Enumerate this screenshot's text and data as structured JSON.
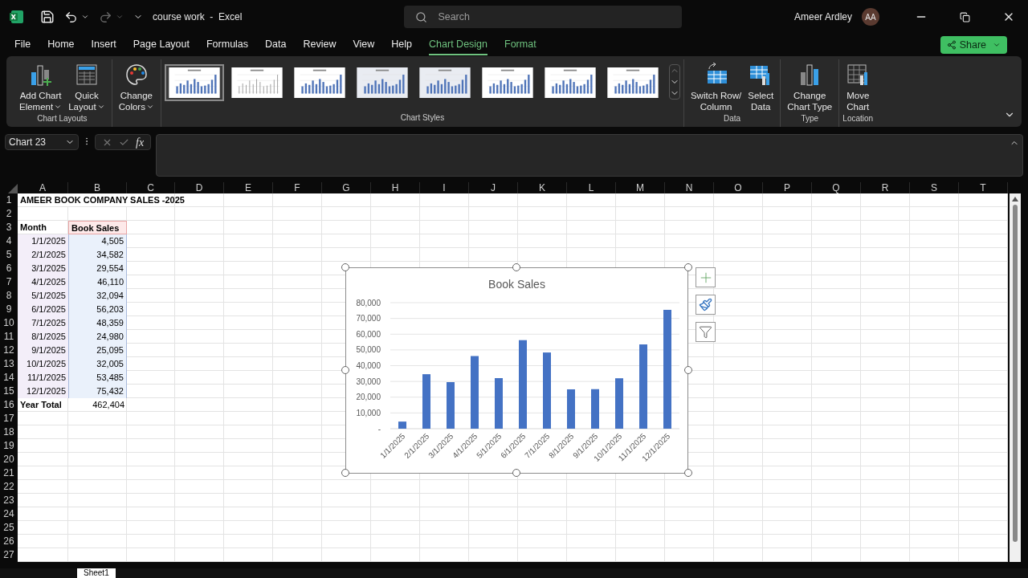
{
  "title_bar": {
    "document_title": "course work  -  Excel",
    "search": {
      "placeholder": "Search"
    },
    "user_name": "Ameer Ardley",
    "avatar_initials": "AA"
  },
  "menu_tabs": [
    {
      "label": "File",
      "selected": false,
      "contextual": false
    },
    {
      "label": "Home",
      "selected": false,
      "contextual": false
    },
    {
      "label": "Insert",
      "selected": false,
      "contextual": false
    },
    {
      "label": "Page Layout",
      "selected": false,
      "contextual": false
    },
    {
      "label": "Formulas",
      "selected": false,
      "contextual": false
    },
    {
      "label": "Data",
      "selected": false,
      "contextual": false
    },
    {
      "label": "Review",
      "selected": false,
      "contextual": false
    },
    {
      "label": "View",
      "selected": false,
      "contextual": false
    },
    {
      "label": "Help",
      "selected": false,
      "contextual": false
    },
    {
      "label": "Chart Design",
      "selected": true,
      "contextual": true
    },
    {
      "label": "Format",
      "selected": false,
      "contextual": true
    }
  ],
  "share_button": {
    "label": "Share"
  },
  "ribbon": {
    "groups": [
      {
        "label": "Chart Layouts",
        "kind": "buttons",
        "buttons": [
          {
            "lines": [
              "Add Chart",
              "Element"
            ],
            "dropdown": true
          },
          {
            "lines": [
              "Quick",
              "Layout"
            ],
            "dropdown": true
          }
        ]
      },
      {
        "kind": "buttons",
        "buttons": [
          {
            "lines": [
              "Change",
              "Colors"
            ],
            "dropdown": true
          }
        ]
      },
      {
        "label": "Chart Styles",
        "kind": "gallery",
        "styles": [
          {
            "selected": true
          },
          {
            "selected": false
          },
          {
            "selected": false
          },
          {
            "selected": false
          },
          {
            "selected": false
          },
          {
            "selected": false
          },
          {
            "selected": false
          },
          {
            "selected": false
          }
        ]
      },
      {
        "label": "Data",
        "kind": "buttons",
        "buttons": [
          {
            "lines": [
              "Switch Row/",
              "Column"
            ],
            "dropdown": false
          },
          {
            "lines": [
              "Select",
              "Data"
            ],
            "dropdown": false
          }
        ]
      },
      {
        "label": "Type",
        "kind": "buttons",
        "buttons": [
          {
            "lines": [
              "Change",
              "Chart Type"
            ],
            "dropdown": false
          }
        ]
      },
      {
        "label": "Location",
        "kind": "buttons",
        "buttons": [
          {
            "lines": [
              "Move",
              "Chart"
            ],
            "dropdown": false
          }
        ]
      }
    ]
  },
  "formula_bar": {
    "name_box": "Chart 23",
    "function_label": "fx"
  },
  "sheet": {
    "columns": [
      "A",
      "B",
      "C",
      "D",
      "E",
      "F",
      "G",
      "H",
      "I",
      "J",
      "K",
      "L",
      "M",
      "N",
      "O",
      "P",
      "Q",
      "R",
      "S",
      "T"
    ],
    "rows": [
      {
        "number": "1",
        "cells": [
          {
            "text": "AMEER BOOK COMPANY SALES -2025",
            "kind": "title"
          }
        ]
      },
      {
        "number": "2",
        "cells": []
      },
      {
        "number": "3",
        "cells": [
          {
            "text": "Month",
            "kind": "label"
          },
          {
            "text": "Book Sales",
            "kind": "series_name"
          }
        ]
      },
      {
        "number": "4",
        "cells": [
          {
            "text": "1/1/2025",
            "kind": "category"
          },
          {
            "text": "4,505",
            "kind": "value"
          }
        ]
      },
      {
        "number": "5",
        "cells": [
          {
            "text": "2/1/2025",
            "kind": "category"
          },
          {
            "text": "34,582",
            "kind": "value"
          }
        ]
      },
      {
        "number": "6",
        "cells": [
          {
            "text": "3/1/2025",
            "kind": "category"
          },
          {
            "text": "29,554",
            "kind": "value"
          }
        ]
      },
      {
        "number": "7",
        "cells": [
          {
            "text": "4/1/2025",
            "kind": "category"
          },
          {
            "text": "46,110",
            "kind": "value"
          }
        ]
      },
      {
        "number": "8",
        "cells": [
          {
            "text": "5/1/2025",
            "kind": "category"
          },
          {
            "text": "32,094",
            "kind": "value"
          }
        ]
      },
      {
        "number": "9",
        "cells": [
          {
            "text": "6/1/2025",
            "kind": "category"
          },
          {
            "text": "56,203",
            "kind": "value"
          }
        ]
      },
      {
        "number": "10",
        "cells": [
          {
            "text": "7/1/2025",
            "kind": "category"
          },
          {
            "text": "48,359",
            "kind": "value"
          }
        ]
      },
      {
        "number": "11",
        "cells": [
          {
            "text": "8/1/2025",
            "kind": "category"
          },
          {
            "text": "24,980",
            "kind": "value"
          }
        ]
      },
      {
        "number": "12",
        "cells": [
          {
            "text": "9/1/2025",
            "kind": "category"
          },
          {
            "text": "25,095",
            "kind": "value"
          }
        ]
      },
      {
        "number": "13",
        "cells": [
          {
            "text": "10/1/2025",
            "kind": "category"
          },
          {
            "text": "32,005",
            "kind": "value"
          }
        ]
      },
      {
        "number": "14",
        "cells": [
          {
            "text": "11/1/2025",
            "kind": "category"
          },
          {
            "text": "53,485",
            "kind": "value"
          }
        ]
      },
      {
        "number": "15",
        "cells": [
          {
            "text": "12/1/2025",
            "kind": "category"
          },
          {
            "text": "75,432",
            "kind": "value"
          }
        ]
      },
      {
        "number": "16",
        "cells": [
          {
            "text": "Year Total",
            "kind": "label"
          },
          {
            "text": "462,404",
            "kind": "total"
          }
        ]
      },
      {
        "number": "17",
        "cells": []
      },
      {
        "number": "18",
        "cells": []
      },
      {
        "number": "19",
        "cells": []
      },
      {
        "number": "20",
        "cells": []
      },
      {
        "number": "21",
        "cells": []
      },
      {
        "number": "22",
        "cells": []
      },
      {
        "number": "23",
        "cells": []
      },
      {
        "number": "24",
        "cells": []
      },
      {
        "number": "25",
        "cells": []
      },
      {
        "number": "26",
        "cells": []
      },
      {
        "number": "27",
        "cells": []
      }
    ]
  },
  "chart": {
    "chart_data": {
      "type": "bar",
      "title": "Book Sales",
      "categories": [
        "1/1/2025",
        "2/1/2025",
        "3/1/2025",
        "4/1/2025",
        "5/1/2025",
        "6/1/2025",
        "7/1/2025",
        "8/1/2025",
        "9/1/2025",
        "10/1/2025",
        "11/1/2025",
        "12/1/2025"
      ],
      "values": [
        4505,
        34582,
        29554,
        46110,
        32094,
        56203,
        48359,
        24980,
        25095,
        32005,
        53485,
        75432
      ],
      "grid": true,
      "ylim": [
        0,
        80000
      ],
      "yticks": [
        {
          "value": 0,
          "label": "-"
        },
        {
          "value": 10000,
          "label": "10,000"
        },
        {
          "value": 20000,
          "label": "20,000"
        },
        {
          "value": 30000,
          "label": "30,000"
        },
        {
          "value": 40000,
          "label": "40,000"
        },
        {
          "value": 50000,
          "label": "50,000"
        },
        {
          "value": 60000,
          "label": "60,000"
        },
        {
          "value": 70000,
          "label": "70,000"
        },
        {
          "value": 80000,
          "label": "80,000"
        }
      ]
    }
  },
  "sheet_tabs": [
    {
      "label": "Sheet1",
      "selected": true
    }
  ]
}
